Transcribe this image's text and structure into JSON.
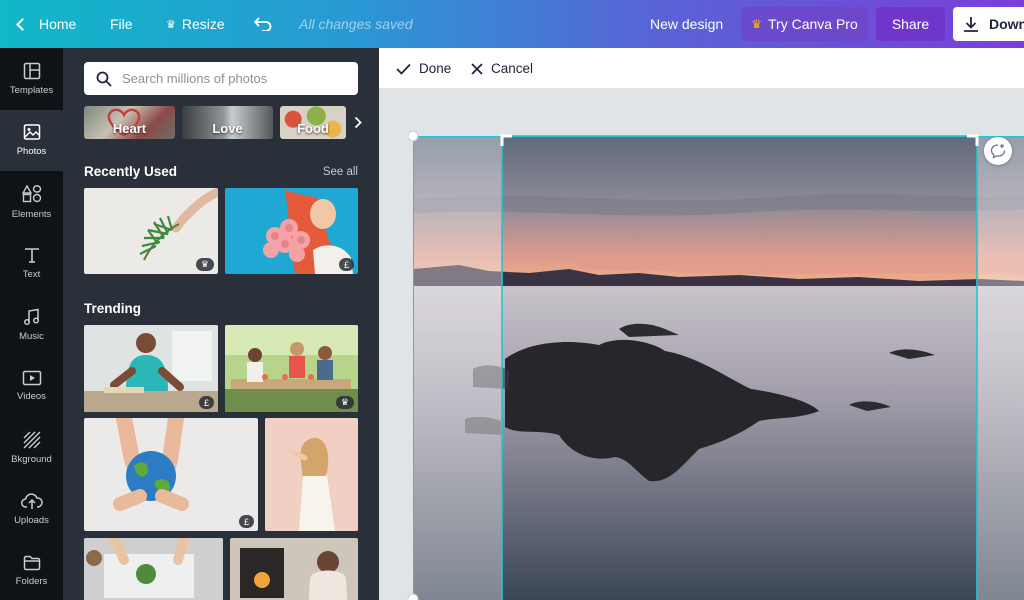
{
  "topbar": {
    "home": "Home",
    "file": "File",
    "resize": "Resize",
    "saved": "All changes saved",
    "new_design": "New design",
    "try_pro": "Try Canva Pro",
    "share": "Share",
    "download": "Download"
  },
  "rail": {
    "items": [
      {
        "label": "Templates",
        "icon": "templates-icon"
      },
      {
        "label": "Photos",
        "icon": "photo-icon"
      },
      {
        "label": "Elements",
        "icon": "shapes-icon"
      },
      {
        "label": "Text",
        "icon": "text-icon"
      },
      {
        "label": "Music",
        "icon": "music-icon"
      },
      {
        "label": "Videos",
        "icon": "video-icon"
      },
      {
        "label": "Bkground",
        "icon": "background-icon"
      },
      {
        "label": "Uploads",
        "icon": "upload-icon"
      },
      {
        "label": "Folders",
        "icon": "folder-icon"
      }
    ]
  },
  "panel": {
    "search_placeholder": "Search millions of photos",
    "chips": [
      "Heart",
      "Love",
      "Food"
    ],
    "recent_title": "Recently Used",
    "see_all": "See all",
    "trending_title": "Trending",
    "badges": {
      "crown": "♛",
      "paid": "£"
    }
  },
  "crop": {
    "done": "Done",
    "cancel": "Cancel"
  },
  "colors": {
    "accent_selection": "#1fc7d4",
    "panel_bg": "#293039",
    "rail_bg": "#0e1318"
  }
}
